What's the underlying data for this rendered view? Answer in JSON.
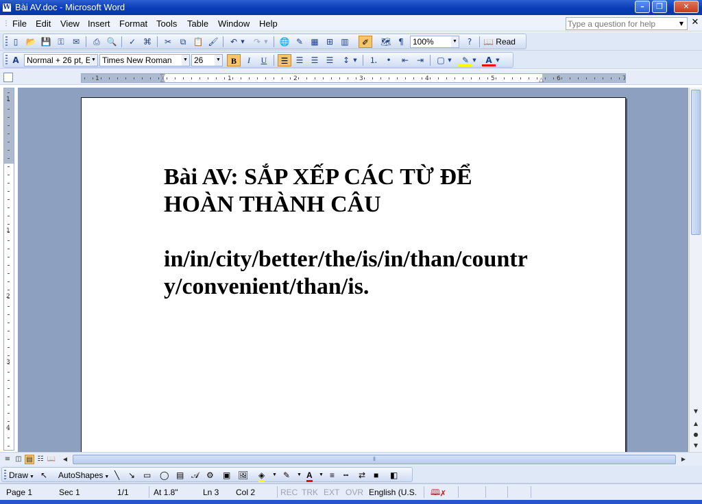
{
  "window": {
    "title": "Bài AV.doc - Microsoft Word",
    "app_icon": "W",
    "minimize": "–",
    "maximize": "❐",
    "close": "✕"
  },
  "menu": {
    "items": [
      "File",
      "Edit",
      "View",
      "Insert",
      "Format",
      "Tools",
      "Table",
      "Window",
      "Help"
    ],
    "help_placeholder": "Type a question for help",
    "doc_close": "✕"
  },
  "standard_toolbar": {
    "zoom": "100%",
    "read_label": "Read"
  },
  "formatting_toolbar": {
    "style": "Normal + 26 pt, E",
    "font": "Times New Roman",
    "size": "26",
    "bold": "B",
    "italic": "I",
    "underline": "U"
  },
  "ruler": {
    "h_numbers": [
      "1",
      "1",
      "2",
      "3",
      "4",
      "5",
      "6",
      "7"
    ],
    "v_numbers": [
      "1",
      "1",
      "2",
      "3",
      "4"
    ]
  },
  "document": {
    "lines": [
      "Bài AV: SẮP XẾP CÁC TỪ ĐỂ",
      "HOÀN THÀNH CÂU",
      "",
      "in/in/city/better/the/is/in/than/countr",
      "y/convenient/than/is."
    ]
  },
  "drawing_toolbar": {
    "draw_label": "Draw",
    "autoshapes_label": "AutoShapes"
  },
  "status": {
    "page": "Page  1",
    "sec": "Sec  1",
    "pages": "1/1",
    "at": "At  1.8\"",
    "ln": "Ln  3",
    "col": "Col  2",
    "rec": "REC",
    "trk": "TRK",
    "ext": "EXT",
    "ovr": "OVR",
    "lang": "English (U.S."
  },
  "colors": {
    "highlight": "#ffff00",
    "font_color": "#ff0000",
    "workspace": "#8da0bf"
  }
}
